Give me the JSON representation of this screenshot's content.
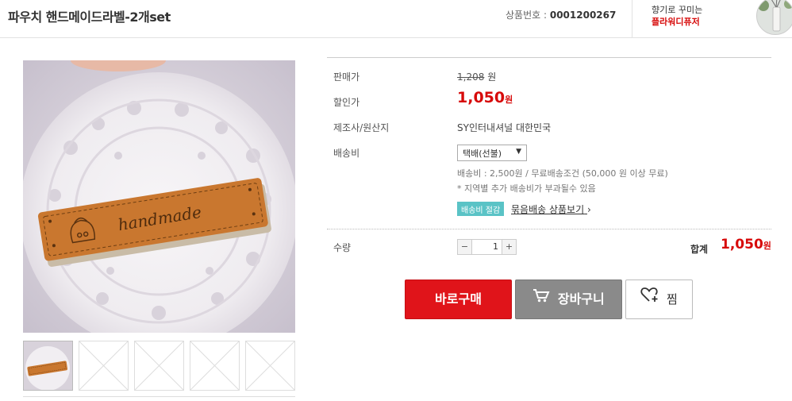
{
  "header": {
    "title": "파우치 핸드메이드라벨-2개set",
    "code_label": "상품번호 :",
    "code_value": "0001200267",
    "seller_slogan": "향기로 꾸미는",
    "seller_name": "플라워디퓨저"
  },
  "gallery": {
    "main_image": "handmade-leather-label-on-lace-doily",
    "label_text": "handmade",
    "thumbnails": [
      "product-thumbnail",
      "empty-placeholder",
      "empty-placeholder",
      "empty-placeholder",
      "empty-placeholder"
    ]
  },
  "info": {
    "list_price_label": "판매가",
    "list_price_value": "1,208",
    "list_price_unit": "원",
    "sale_price_label": "할인가",
    "sale_price_value": "1,050",
    "sale_price_unit": "원",
    "maker_label": "제조사/원산지",
    "maker_value": "SY인터내셔널 대한민국",
    "shipping_label": "배송비",
    "shipping_selected": "택배(선불)",
    "shipping_fee_text": "배송비 : 2,500원 / 무료배송조건 (50,000 원 이상 무료)",
    "shipping_note": "* 지역별 추가 배송비가 부과될수 있음",
    "bundle_badge": "배송비 절감",
    "bundle_link": "묶음배송 상품보기",
    "bundle_arrow": "›",
    "quantity_label": "수량",
    "quantity_value": "1",
    "minus": "−",
    "plus": "+",
    "total_label": "합계",
    "total_value": "1,050",
    "total_unit": "원"
  },
  "actions": {
    "buy_label": "바로구매",
    "cart_label": "장바구니",
    "wish_label": "찜"
  },
  "colors": {
    "accent_red": "#e0141a",
    "price_red": "#d70a0a",
    "badge_teal": "#5ac3c6",
    "cart_gray": "#8a8a8a"
  }
}
